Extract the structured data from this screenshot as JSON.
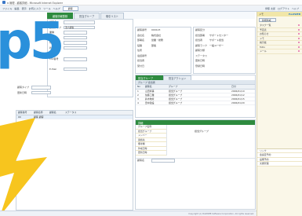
{
  "window": {
    "title": "e-管理 - 顧客詳細 - Microsoft Internet Explorer"
  },
  "menubar": {
    "items": [
      "ファイル",
      "編集",
      "表示",
      "お気に入り",
      "ツール",
      "ヘルプ"
    ],
    "selector_value": "顧客",
    "right_items": [
      "伊藤 太郎",
      "ログアウト",
      "ヘルプ"
    ]
  },
  "tabs": [
    {
      "label": "顧客情報登録"
    },
    {
      "label": "担当グループ"
    },
    {
      "label": "取引リスト"
    }
  ],
  "logo": {
    "text": "p5"
  },
  "left_form": {
    "fields": [
      {
        "label": "顧客名",
        "value": ""
      },
      {
        "label": "顧客タイプ",
        "value": "法人顧客"
      },
      {
        "label": "業種",
        "value": ""
      },
      {
        "label": "地域",
        "value": ""
      },
      {
        "label": "規模",
        "value": ""
      },
      {
        "label": "状態",
        "value": ""
      }
    ],
    "memo_label": "FAX番号",
    "memo2_label": "E-Mail"
  },
  "middle_form": {
    "fields": [
      {
        "label": "顧客番号",
        "value": "000123"
      },
      {
        "label": "会社名",
        "value": "株式会社"
      },
      {
        "label": "部署名",
        "value": "営業・総務"
      },
      {
        "label": "役職",
        "value": "部長"
      },
      {
        "label": "住所",
        "value": ""
      },
      {
        "label": "電話番号",
        "value": ""
      },
      {
        "label": "担当者",
        "value": ""
      },
      {
        "label": "受付日",
        "value": ""
      }
    ]
  },
  "right_form": {
    "fields": [
      {
        "label": "顧客区分",
        "value": ""
      },
      {
        "label": "担当部署",
        "value": "サポートセンター"
      },
      {
        "label": "担当者",
        "value": "サポート担当"
      },
      {
        "label": "顧客ランク",
        "value": "一般ユーザー"
      },
      {
        "label": "顧客分類",
        "value": ""
      },
      {
        "label": "ステータス",
        "value": ""
      },
      {
        "label": "更新日時",
        "value": ""
      },
      {
        "label": "登録日時",
        "value": ""
      }
    ]
  },
  "contacts": {
    "tabs": [
      "担当グループ",
      "担当アクション"
    ],
    "sub_header": "グループ 担当者",
    "columns": [
      "No",
      "顧客名",
      "グループ",
      "日付"
    ],
    "rows": [
      {
        "no": "1",
        "name": "山田商事",
        "group": "担当グループ",
        "date": "2006/01/10"
      },
      {
        "no": "2",
        "name": "佐藤工業",
        "group": "担当グループ",
        "date": "2006/01/12"
      },
      {
        "no": "3",
        "name": "鈴木物産",
        "group": "担当グループ",
        "date": "2006/01/15"
      },
      {
        "no": "4",
        "name": "田中建設",
        "group": "担当グループ",
        "date": "2006/01/20"
      }
    ]
  },
  "left_bottom": {
    "label1": "顧客タイプ",
    "label2": "更新日時",
    "columns": [
      "顧客番号",
      "顧客名称",
      "顧客名",
      "ステータス"
    ],
    "rows": [
      {
        "c1": "00",
        "c2": "顧客 顧客"
      }
    ]
  },
  "detail": {
    "header": "詳細",
    "items": [
      "グループ名称",
      "担当グループ",
      "メンバー",
      "連絡先",
      "備考欄",
      "作成日時",
      "更新日時"
    ],
    "right_value": "担当グループ",
    "footer_label": "顧客名"
  },
  "right_pane": {
    "header": "メモ",
    "logo_text": "PostWEB",
    "buttons": [
      "新規作成"
    ],
    "items": [
      "タスク一覧",
      "予定表",
      "お知らせ",
      "メモ",
      "掲示板",
      "ToDo",
      "メール"
    ],
    "lower_items": [
      "リンク",
      "会議室予約",
      "設備予約",
      "文書管理"
    ]
  },
  "bottom_bar": {
    "copyright": "Copyright (c) PostWEB Software Corporation. All rights reserved."
  }
}
